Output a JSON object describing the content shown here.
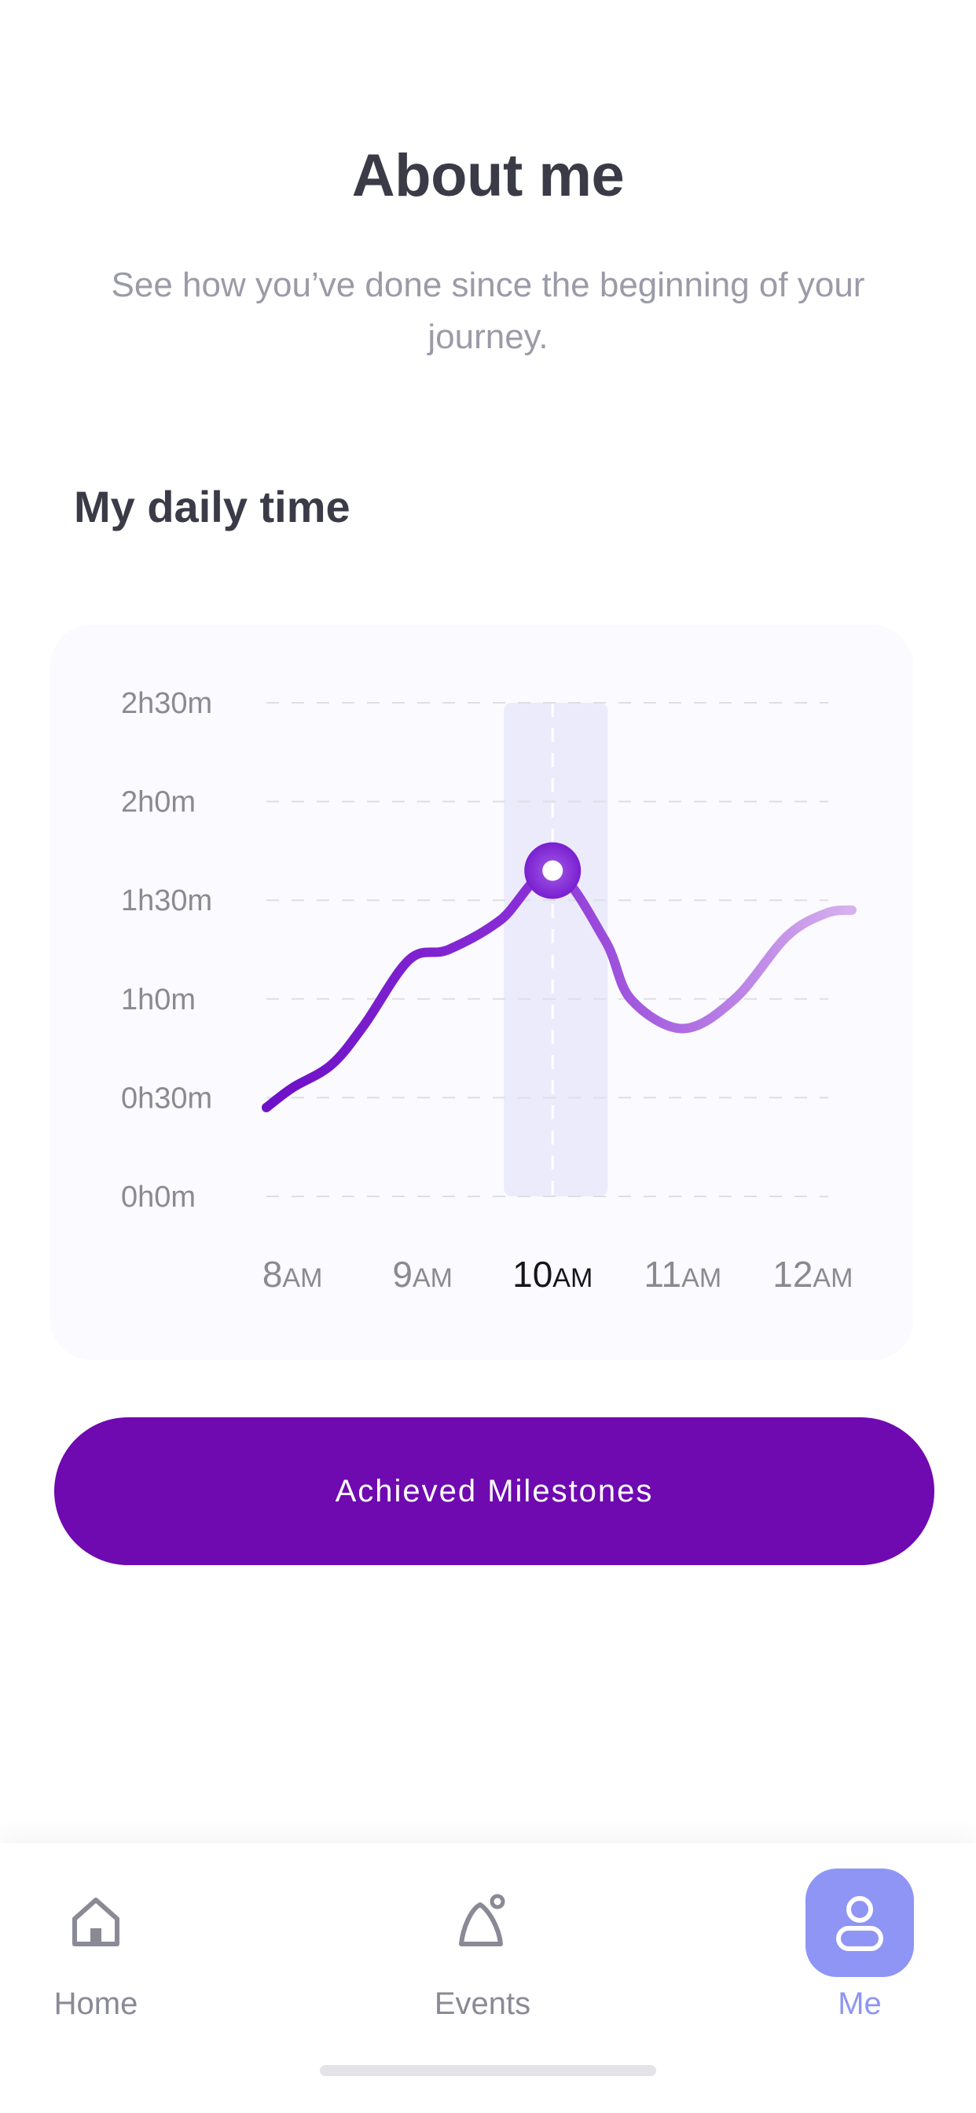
{
  "header": {
    "title": "About me",
    "subtitle": "See how you’ve done since the beginning of your journey."
  },
  "section": {
    "title": "My daily time"
  },
  "chart_data": {
    "type": "line",
    "title": "",
    "xlabel": "",
    "ylabel": "",
    "y_tick_labels": [
      "0h0m",
      "0h30m",
      "1h0m",
      "1h30m",
      "2h0m",
      "2h30m"
    ],
    "y_ticks_minutes": [
      0,
      30,
      60,
      90,
      120,
      150
    ],
    "ylim_minutes": [
      0,
      150
    ],
    "x_tick_labels": [
      {
        "hour": "8",
        "suffix": "AM"
      },
      {
        "hour": "9",
        "suffix": "AM"
      },
      {
        "hour": "10",
        "suffix": "AM"
      },
      {
        "hour": "11",
        "suffix": "AM"
      },
      {
        "hour": "12",
        "suffix": "AM"
      }
    ],
    "x_hours": [
      8,
      9,
      10,
      11,
      12
    ],
    "xlim_hours": [
      7.8,
      12.3
    ],
    "series": [
      {
        "x": [
          7.8,
          8.0,
          8.3,
          8.55,
          8.9,
          9.2,
          9.6,
          10.0,
          10.4,
          10.6,
          11.0,
          11.4,
          11.8,
          12.1,
          12.3
        ],
        "values": [
          27,
          33,
          40,
          52,
          72,
          75,
          84,
          99,
          78,
          60,
          51,
          60,
          79,
          86,
          87
        ]
      }
    ],
    "highlight": {
      "x": 10.0,
      "value": 99,
      "label": "10AM"
    },
    "grid": true,
    "legend": "none",
    "colors": {
      "line_start": "#6d10c7",
      "line_end": "#d6b1ee",
      "marker": "#7a1fd0",
      "highlight_band": "#ebebfc",
      "grid": "#dedee4",
      "tick_label": "#8a8a90",
      "tick_label_active": "#15151a"
    }
  },
  "primary_action": {
    "label": "Achieved Milestones",
    "color": "#6f09b0"
  },
  "tab_bar": {
    "items": [
      {
        "label": "Home",
        "icon": "home-icon",
        "active": false
      },
      {
        "label": "Events",
        "icon": "bell-icon",
        "active": false
      },
      {
        "label": "Me",
        "icon": "person-icon",
        "active": true
      }
    ],
    "active_color": "#8f95f5"
  }
}
